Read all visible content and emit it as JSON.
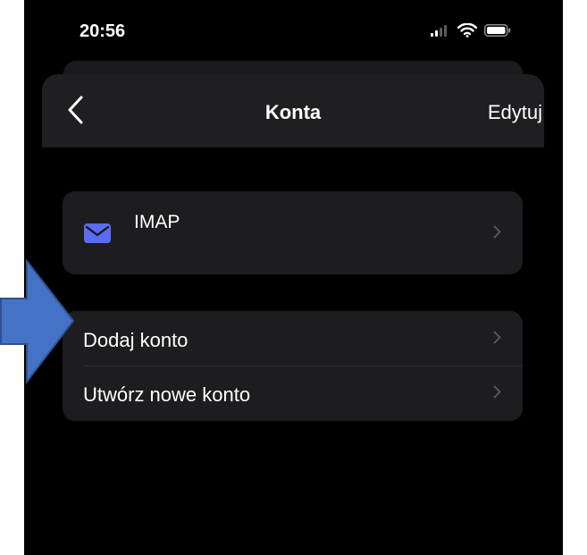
{
  "status_bar": {
    "time": "20:56"
  },
  "nav": {
    "title": "Konta",
    "edit_label": "Edytuj"
  },
  "accounts": [
    {
      "label": "IMAP",
      "icon": "mail-icon"
    }
  ],
  "actions": [
    {
      "label": "Dodaj konto"
    },
    {
      "label": "Utwórz nowe konto"
    }
  ],
  "colors": {
    "background": "#000000",
    "cell": "#1d1d1f",
    "mail_icon": "#5b6cf6",
    "arrow_fill": "#4472c4",
    "arrow_stroke": "#2f528f"
  }
}
